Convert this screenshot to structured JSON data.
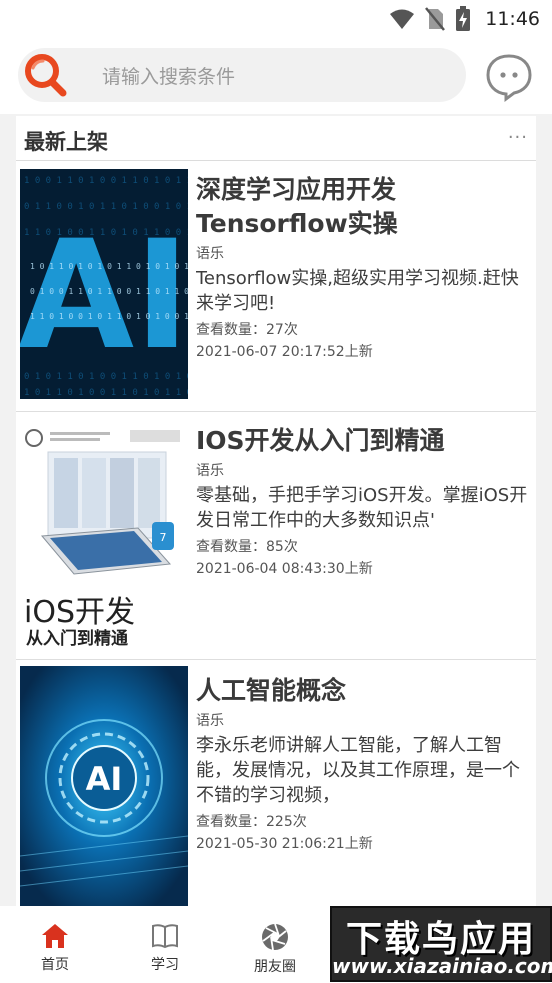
{
  "status_bar": {
    "time": "11:46"
  },
  "search": {
    "placeholder": "请输入搜索条件"
  },
  "section": {
    "title": "最新上架",
    "more": "..."
  },
  "courses": [
    {
      "title": "深度学习应用开发Tensorflow实操",
      "author": "语乐",
      "description": "Tensorflow实操,超级实用学习视频.赶快来学习吧!",
      "views": "查看数量：27次",
      "date": "2021-06-07 20:17:52上新",
      "thumb_text": "AI"
    },
    {
      "title": "IOS开发从入门到精通",
      "author": "语乐",
      "description": "零基础，手把手学习iOS开发。掌握iOS开发日常工作中的大多数知识点'",
      "views": "查看数量：85次",
      "date": "2021-06-04 08:43:30上新",
      "thumb_text": "iOS开发",
      "thumb_sub": "从入门到精通"
    },
    {
      "title": "人工智能概念",
      "author": "语乐",
      "description": "李永乐老师讲解人工智能，了解人工智能，发展情况，以及其工作原理，是一个不错的学习视频，",
      "views": "查看数量：225次",
      "date": "2021-05-30 21:06:21上新",
      "thumb_text": "AI"
    }
  ],
  "nav": [
    {
      "label": "首页",
      "icon": "home-icon",
      "active": true
    },
    {
      "label": "学习",
      "icon": "book-icon",
      "active": false
    },
    {
      "label": "朋友圈",
      "icon": "aperture-icon",
      "active": false
    }
  ],
  "watermark": {
    "main": "下载鸟应用",
    "sub": "www.xiazainiao.com"
  },
  "colors": {
    "accent": "#e8481f",
    "home_active": "#d9321e"
  }
}
